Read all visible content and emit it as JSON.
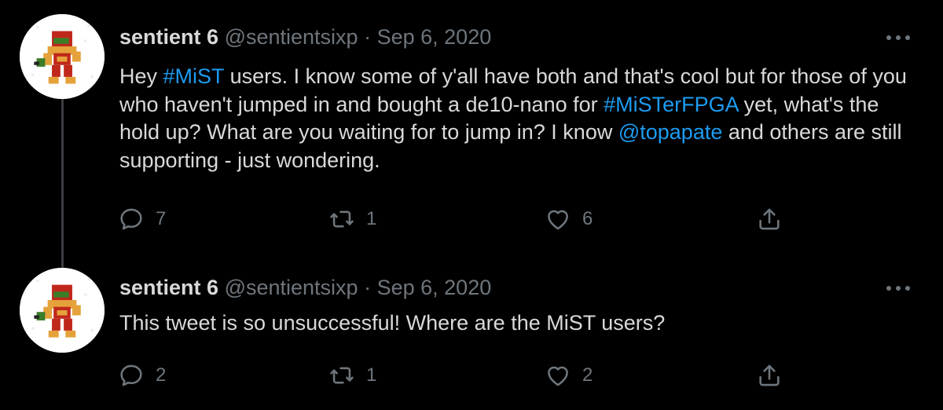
{
  "colors": {
    "background": "#000000",
    "text": "#d9d9d9",
    "secondary": "#6e767d",
    "link": "#1d9bf0",
    "thread_line": "#3a3d41"
  },
  "tweets": [
    {
      "author": "sentient 6",
      "handle": "@sentientsixp",
      "separator": "·",
      "date": "Sep 6, 2020",
      "text": {
        "t1": "Hey ",
        "l1": "#MiST",
        "t2": " users. I know some of y'all have both and that's cool but for those of you who haven't jumped in and bought a de10-nano for ",
        "l2": "#MiSTerFPGA",
        "t3": " yet, what's the hold up? What are you waiting for to jump in? I know ",
        "l3": "@topapate",
        "t4": " and others are still supporting - just wondering."
      },
      "replies": "7",
      "retweets": "1",
      "likes": "6",
      "avatar_icon": "pixel-art-avatar-icon"
    },
    {
      "author": "sentient 6",
      "handle": "@sentientsixp",
      "separator": "·",
      "date": "Sep 6, 2020",
      "text": {
        "t1": "This tweet is so unsuccessful! Where are the MiST users?"
      },
      "replies": "2",
      "retweets": "1",
      "likes": "2",
      "avatar_icon": "pixel-art-avatar-icon"
    }
  ],
  "icons": {
    "more": "more-icon",
    "reply": "reply-icon",
    "retweet": "retweet-icon",
    "like": "heart-icon",
    "share": "share-icon"
  }
}
